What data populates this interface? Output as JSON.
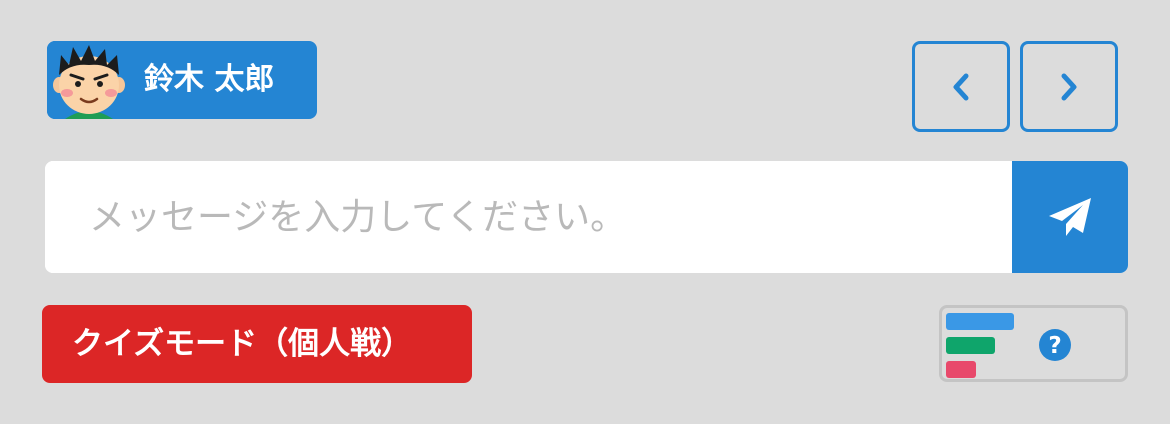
{
  "user": {
    "name": "鈴木 太郎",
    "avatar_icon": "boy-face-avatar-icon"
  },
  "nav": {
    "prev_icon": "chevron-left-icon",
    "next_icon": "chevron-right-icon"
  },
  "message": {
    "placeholder": "メッセージを入力してください。",
    "value": "",
    "send_icon": "paper-plane-icon"
  },
  "quiz": {
    "label": "クイズモード（個人戦）"
  },
  "ranking": {
    "icon": "bar-ranking-icon",
    "help_icon": "question-circle-icon",
    "colors": [
      "#3a98e6",
      "#0fa56b",
      "#e8496b"
    ]
  },
  "colors": {
    "accent": "#2485d3",
    "danger": "#dc2626",
    "background": "#dcdcdc"
  }
}
